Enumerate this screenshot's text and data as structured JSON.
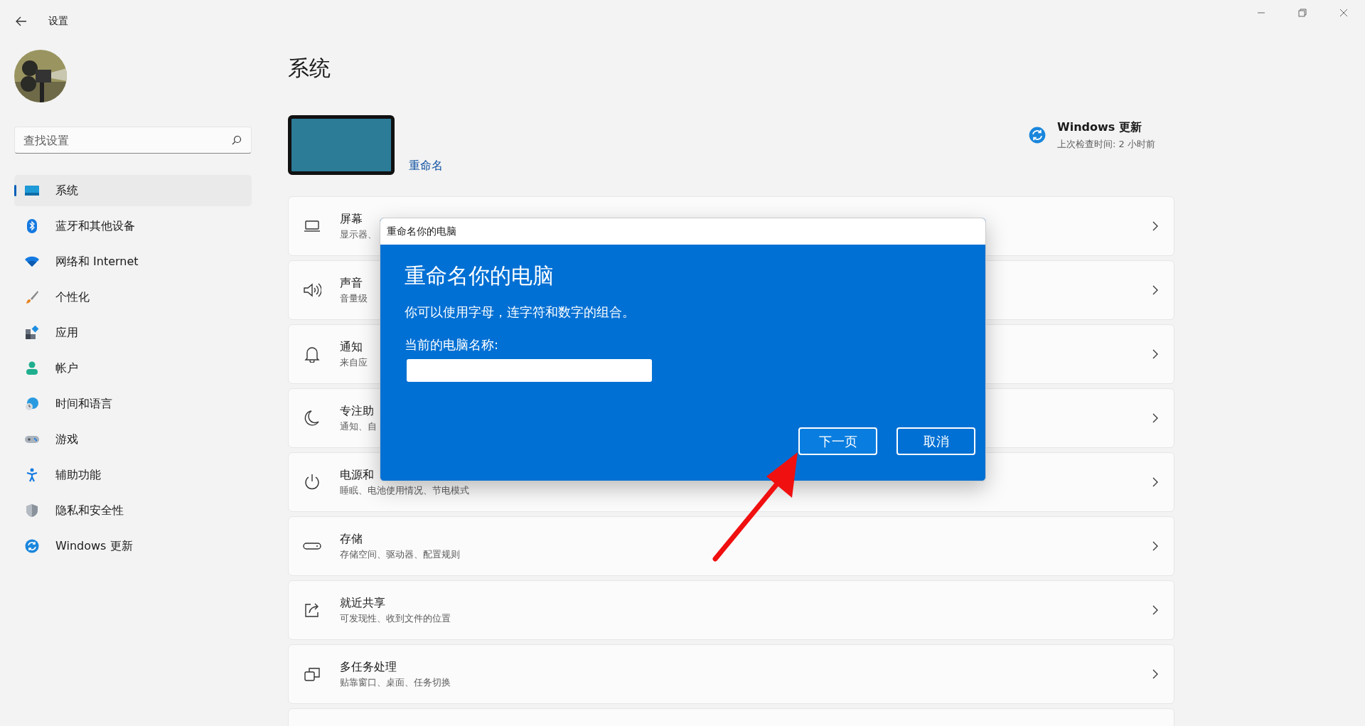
{
  "window": {
    "title": "设置"
  },
  "search": {
    "placeholder": "查找设置"
  },
  "sidebar": {
    "items": [
      {
        "label": "系统",
        "selected": true
      },
      {
        "label": "蓝牙和其他设备",
        "selected": false
      },
      {
        "label": "网络和 Internet",
        "selected": false
      },
      {
        "label": "个性化",
        "selected": false
      },
      {
        "label": "应用",
        "selected": false
      },
      {
        "label": "帐户",
        "selected": false
      },
      {
        "label": "时间和语言",
        "selected": false
      },
      {
        "label": "游戏",
        "selected": false
      },
      {
        "label": "辅助功能",
        "selected": false
      },
      {
        "label": "隐私和安全性",
        "selected": false
      },
      {
        "label": "Windows 更新",
        "selected": false
      }
    ]
  },
  "page_title": "系统",
  "device": {
    "rename_link": "重命名"
  },
  "windows_update": {
    "title": "Windows 更新",
    "subtitle": "上次检查时间: 2 小时前"
  },
  "settings": [
    {
      "title": "屏幕",
      "subtitle": "显示器、"
    },
    {
      "title": "声音",
      "subtitle": "音量级"
    },
    {
      "title": "通知",
      "subtitle": "来自应"
    },
    {
      "title": "专注助",
      "subtitle": "通知、自"
    },
    {
      "title": "电源和",
      "subtitle": "睡眠、电池使用情况、节电模式"
    },
    {
      "title": "存储",
      "subtitle": "存储空间、驱动器、配置规则"
    },
    {
      "title": "就近共享",
      "subtitle": "可发现性、收到文件的位置"
    },
    {
      "title": "多任务处理",
      "subtitle": "贴靠窗口、桌面、任务切换"
    }
  ],
  "dialog": {
    "title": "重命名你的电脑",
    "heading": "重命名你的电脑",
    "description": "你可以使用字母，连字符和数字的组合。",
    "name_label": "当前的电脑名称:",
    "buttons": [
      {
        "label": "下一页",
        "selected": true
      },
      {
        "label": "取消",
        "selected": false
      }
    ]
  }
}
